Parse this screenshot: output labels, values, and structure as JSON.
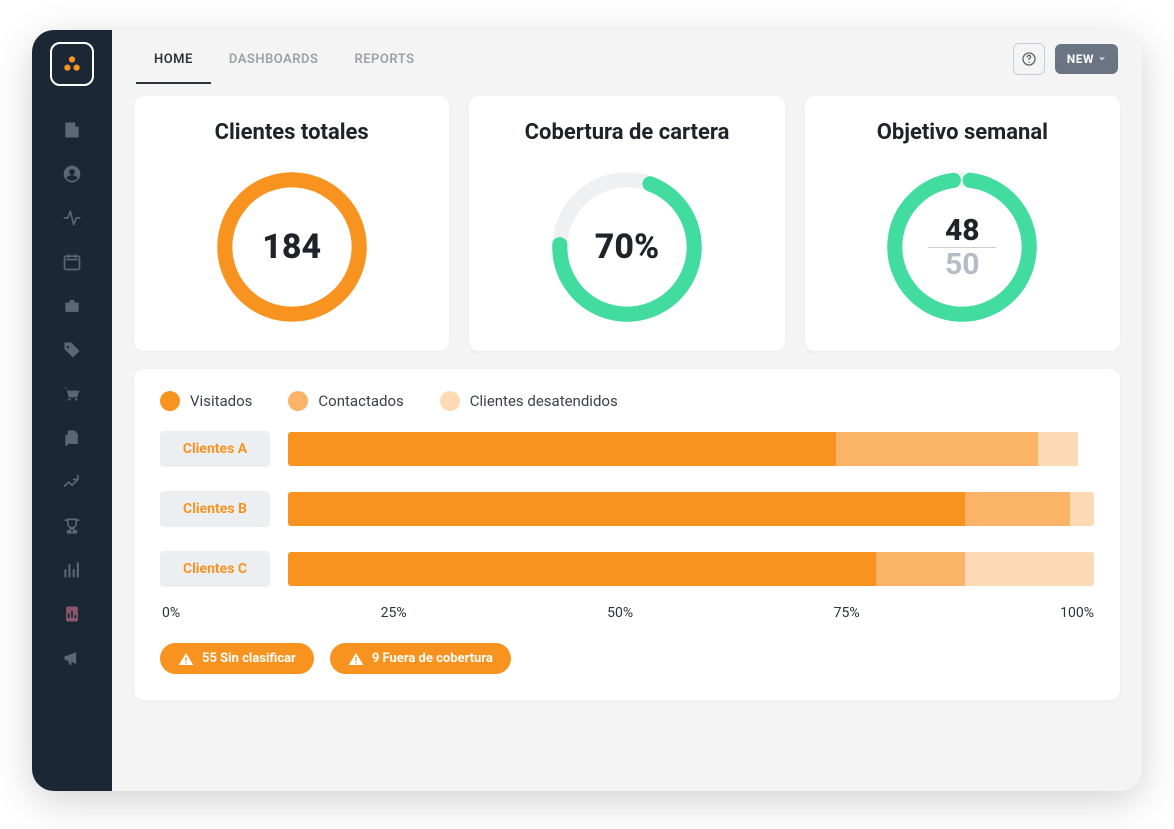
{
  "sidebar": {
    "items": [
      {
        "name": "building-icon"
      },
      {
        "name": "user-circle-icon"
      },
      {
        "name": "activity-icon"
      },
      {
        "name": "calendar-icon"
      },
      {
        "name": "briefcase-icon"
      },
      {
        "name": "tag-icon"
      },
      {
        "name": "cart-icon"
      },
      {
        "name": "files-icon"
      },
      {
        "name": "analytics-icon"
      },
      {
        "name": "trophy-icon"
      },
      {
        "name": "bar-chart-icon"
      },
      {
        "name": "report-icon"
      },
      {
        "name": "megaphone-icon"
      }
    ]
  },
  "topbar": {
    "tabs": [
      {
        "label": "HOME",
        "active": true
      },
      {
        "label": "DASHBOARDS",
        "active": false
      },
      {
        "label": "REPORTS",
        "active": false
      }
    ],
    "new_label": "NEW"
  },
  "cards": {
    "clients_total": {
      "title": "Clientes totales",
      "value": "184",
      "percent": 100,
      "color": "#f7931e"
    },
    "coverage": {
      "title": "Cobertura de cartera",
      "value": "70%",
      "percent": 70,
      "color": "#42dba0"
    },
    "weekly_goal": {
      "title": "Objetivo semanal",
      "numerator": "48",
      "denominator": "50",
      "percent": 96,
      "color": "#42dba0"
    }
  },
  "chart_data": {
    "type": "bar",
    "title": "",
    "xlabel": "",
    "ylabel": "",
    "xlim": [
      0,
      100
    ],
    "x_ticks": [
      "0%",
      "25%",
      "50%",
      "75%",
      "100%"
    ],
    "legend": [
      {
        "label": "Visitados",
        "color": "#f7931e"
      },
      {
        "label": "Contactados",
        "color": "#fab367"
      },
      {
        "label": "Clientes desatendidos",
        "color": "#fcdab4"
      }
    ],
    "categories": [
      "Clientes A",
      "Clientes B",
      "Clientes C"
    ],
    "series": [
      {
        "name": "Visitados",
        "values": [
          68,
          84,
          73
        ]
      },
      {
        "name": "Contactados",
        "values": [
          25,
          13,
          11
        ]
      },
      {
        "name": "Clientes desatendidos",
        "values": [
          5,
          3,
          16
        ]
      }
    ]
  },
  "alerts": [
    {
      "label": "55 Sin clasificar"
    },
    {
      "label": "9 Fuera de cobertura"
    }
  ]
}
